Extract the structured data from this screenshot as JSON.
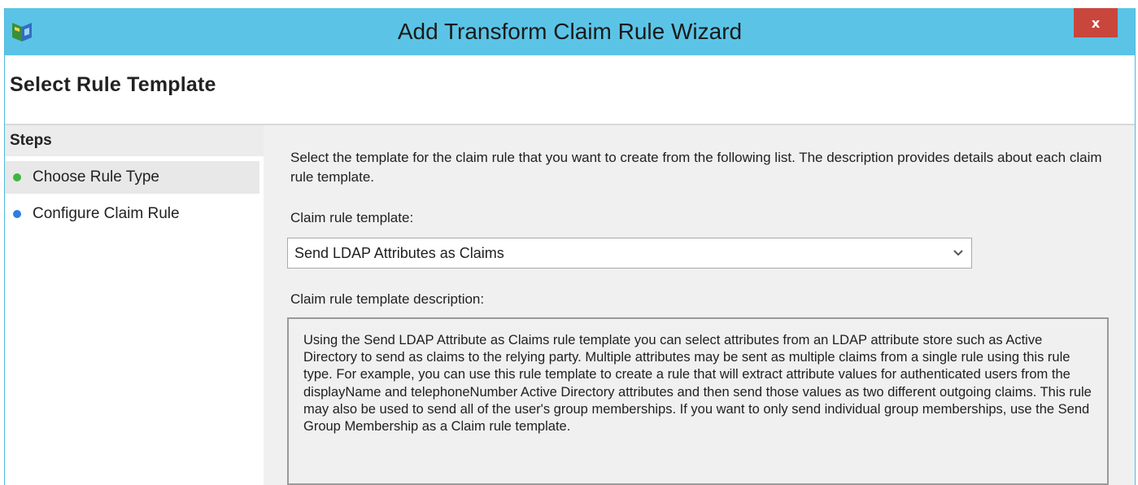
{
  "window": {
    "title": "Add Transform Claim Rule Wizard",
    "close_label": "x",
    "icon": "wizard-app-icon"
  },
  "page": {
    "title": "Select Rule Template"
  },
  "steps": {
    "title": "Steps",
    "items": [
      {
        "label": "Choose Rule Type",
        "status_color": "#3db73d",
        "active": true
      },
      {
        "label": "Configure Claim Rule",
        "status_color": "#2f7de0",
        "active": false
      }
    ]
  },
  "content": {
    "intro": "Select the template for the claim rule that you want to create from the following list. The description provides details about each claim rule template.",
    "template_label": "Claim rule template:",
    "template_value": "Send LDAP Attributes as Claims",
    "description_label": "Claim rule template description:",
    "description": "Using the Send LDAP Attribute as Claims rule template you can select attributes from an LDAP attribute store such as Active Directory to send as claims to the relying party. Multiple attributes may be sent as multiple claims from a single rule using this rule type. For example, you can use this rule template to create a rule that will extract attribute values for authenticated users from the displayName and telephoneNumber Active Directory attributes and then send those values as two different outgoing claims. This rule may also be used to send all of the user's group memberships. If you want to only send individual group memberships, use the Send Group Membership as a Claim rule template."
  },
  "colors": {
    "titlebar": "#5bc4e6",
    "close_button": "#c9463d",
    "active_step_dot": "#3db73d",
    "pending_step_dot": "#2f7de0"
  }
}
